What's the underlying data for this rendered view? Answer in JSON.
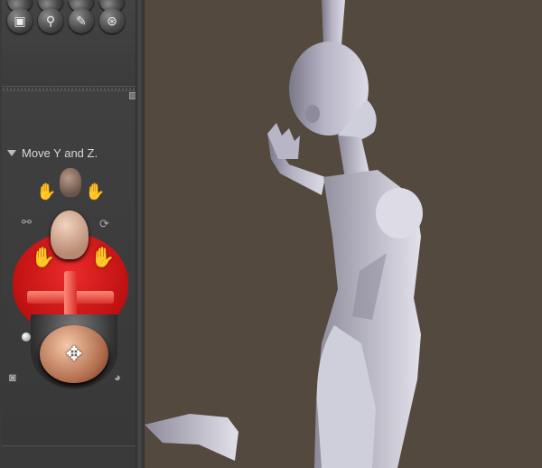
{
  "panel": {
    "tools": [
      {
        "icon": "circle-tool-icon",
        "glyph": "●"
      },
      {
        "icon": "frame-select-icon",
        "glyph": "▣"
      },
      {
        "icon": "zoom-icon",
        "glyph": "⚲"
      },
      {
        "icon": "paint-icon",
        "glyph": "✎"
      },
      {
        "icon": "trackball-icon",
        "glyph": "⊛"
      }
    ],
    "mode_label": "Move Y and Z.",
    "controls": [
      "head-icon",
      "left-hand-icon",
      "right-hand-icon",
      "chain-link-icon",
      "rotate-icon",
      "red-left-hand-icon",
      "red-right-hand-icon",
      "move-cross-icon",
      "camera-trackball-icon"
    ],
    "colors": {
      "active_zone": "#e01010",
      "trackball": "#d08a6a",
      "panel": "#3a3a3a"
    }
  },
  "viewport": {
    "background": "#54493f",
    "figure": "posed-female-figure"
  }
}
